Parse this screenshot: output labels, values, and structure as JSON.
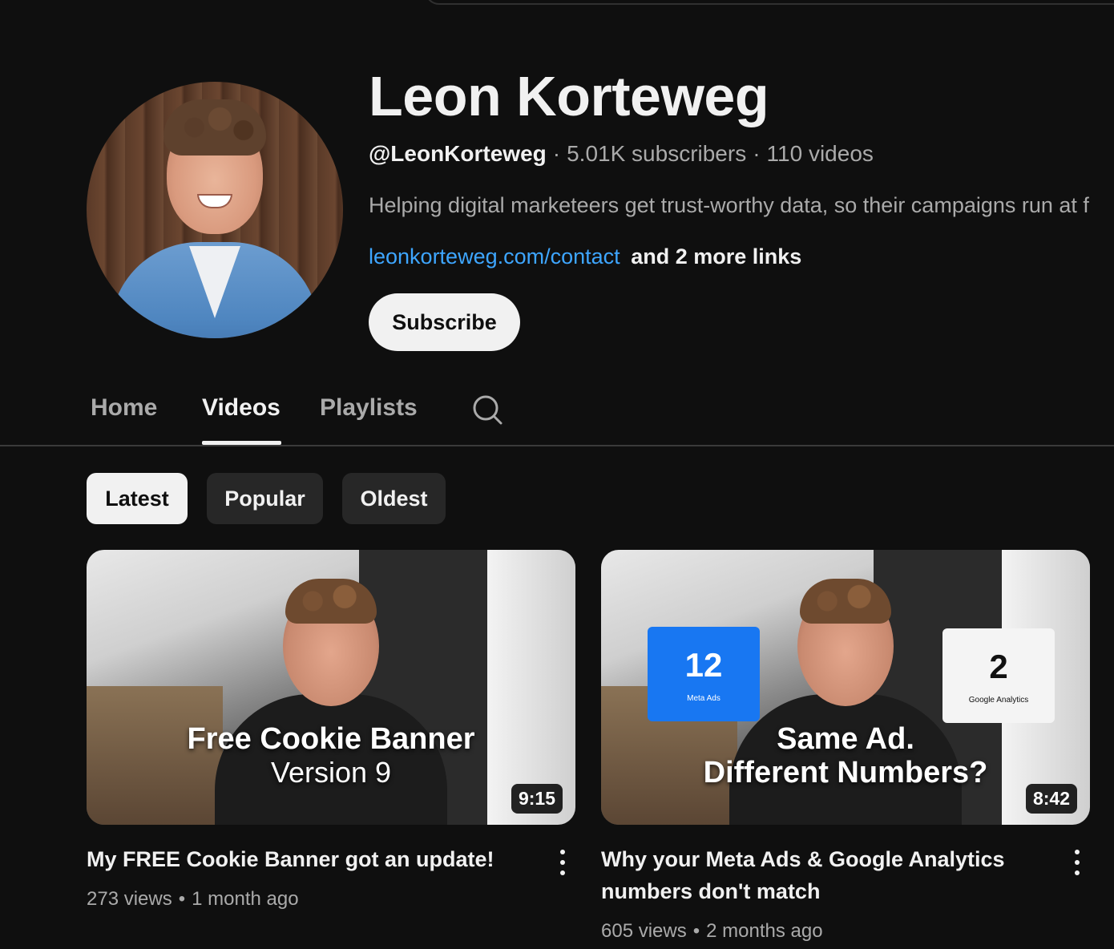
{
  "channel": {
    "name": "Leon Korteweg",
    "handle": "@LeonKorteweg",
    "subscribers": "5.01K subscribers",
    "videos_count": "110 videos",
    "separator": "·",
    "description": "Helping digital marketeers get trust-worthy data, so their campaigns run at f",
    "link": "leonkorteweg.com/contact",
    "more_links": "and 2 more links",
    "subscribe_label": "Subscribe"
  },
  "tabs": [
    {
      "label": "Home",
      "active": false
    },
    {
      "label": "Videos",
      "active": true
    },
    {
      "label": "Playlists",
      "active": false
    }
  ],
  "tab_search_icon": "search-icon",
  "chips": [
    {
      "label": "Latest",
      "active": true
    },
    {
      "label": "Popular",
      "active": false
    },
    {
      "label": "Oldest",
      "active": false
    }
  ],
  "videos": [
    {
      "title": "My FREE Cookie Banner got an update!",
      "views": "273 views",
      "age": "1 month ago",
      "duration": "9:15",
      "thumb_line1": "Free Cookie Banner",
      "thumb_line2": "Version 9"
    },
    {
      "title": "Why your Meta Ads & Google Analytics numbers don't match",
      "views": "605 views",
      "age": "2 months ago",
      "duration": "8:42",
      "thumb_line1": "Same Ad.",
      "thumb_line2": "Different Numbers?",
      "card_left_num": "12",
      "card_left_label": "Meta Ads",
      "card_right_num": "2",
      "card_right_label": "Google Analytics"
    }
  ],
  "meta_separator": "•",
  "colors": {
    "background": "#0f0f0f",
    "link": "#3ea6ff",
    "secondary_text": "#aaaaaa",
    "meta_ads_blue": "#1877f2"
  }
}
